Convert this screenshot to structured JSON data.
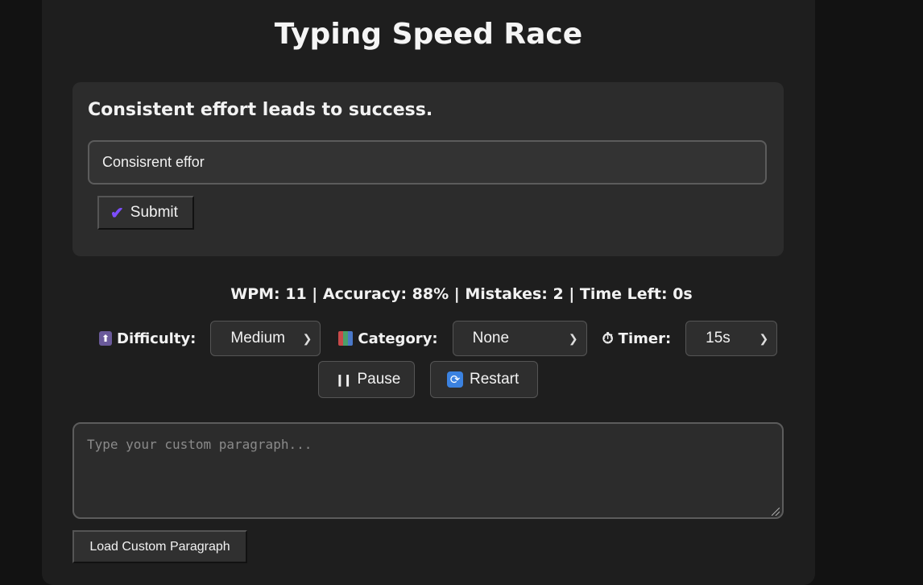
{
  "app": {
    "title": "Typing Speed Race"
  },
  "race": {
    "sentence": "Consistent effort leads to success.",
    "typed_value": "Consisrent effor",
    "submit_label": "Submit",
    "submit_icon": "check-icon"
  },
  "stats": {
    "text": "WPM: 11 | Accuracy: 88% | Mistakes: 2 | Time Left: 0s",
    "wpm": 11,
    "accuracy": "88%",
    "mistakes": 2,
    "time_left": "0s"
  },
  "controls": {
    "difficulty": {
      "label": "Difficulty:",
      "icon": "up-arrow-icon",
      "icon_glyph": "⬆",
      "value": "Medium"
    },
    "category": {
      "label": "Category:",
      "icon": "books-icon",
      "icon_glyph": "📚",
      "value": "None"
    },
    "timer": {
      "label": "Timer:",
      "icon": "stopwatch-icon",
      "icon_glyph": "⏱",
      "value": "15s"
    }
  },
  "actions": {
    "pause_label": "Pause",
    "pause_icon_glyph": "❙❙",
    "restart_label": "Restart",
    "restart_icon_glyph": "⟳"
  },
  "custom": {
    "placeholder": "Type your custom paragraph...",
    "load_label": "Load Custom Paragraph"
  },
  "colors": {
    "page_bg": "#121212",
    "card_bg": "#1e1e1e",
    "panel_bg": "#2c2c2c",
    "accent_check": "#7c4dff",
    "restart_icon_bg": "#3b82e0"
  }
}
